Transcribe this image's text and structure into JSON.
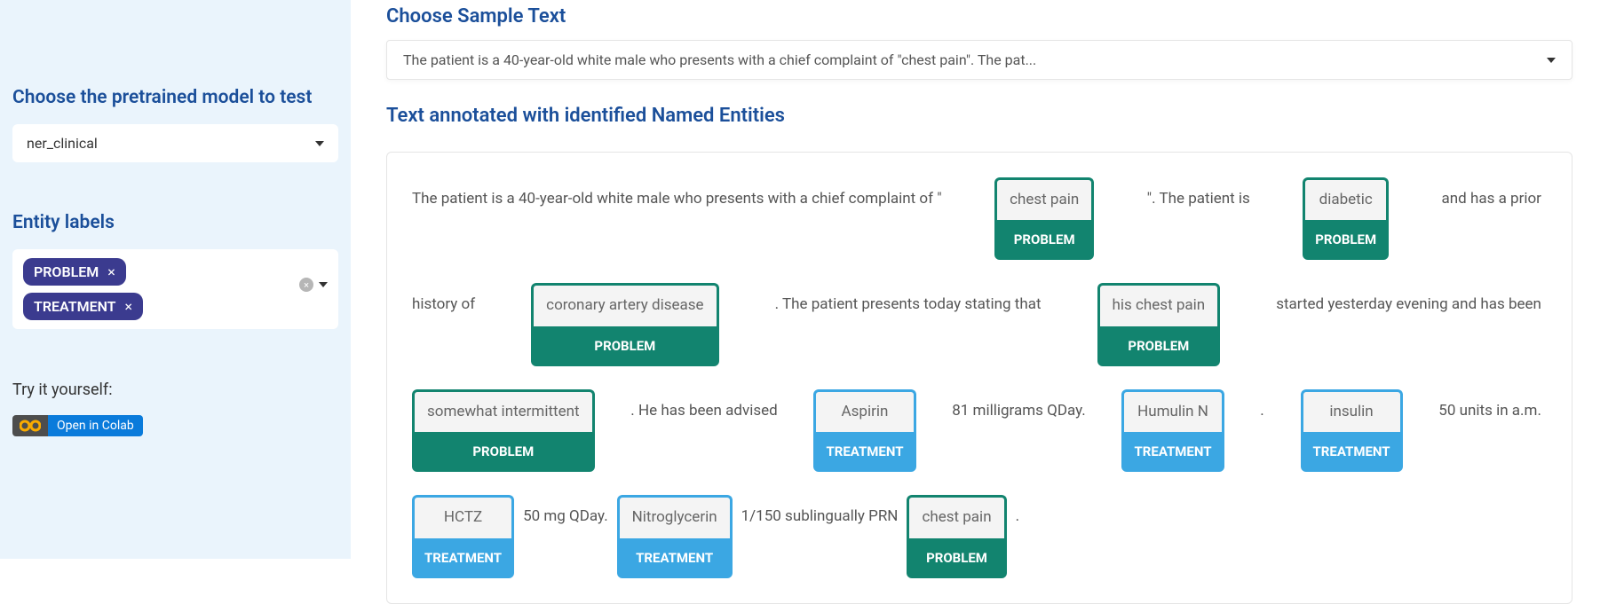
{
  "sidebar": {
    "model_heading": "Choose the pretrained model to test",
    "model_selected": "ner_clinical",
    "entity_heading": "Entity labels",
    "chips": [
      "PROBLEM",
      "TREATMENT"
    ],
    "try_it": "Try it yourself:",
    "colab_label": "Open in Colab"
  },
  "main": {
    "sample_heading": "Choose Sample Text",
    "sample_selected": "The patient is a 40-year-old white male who presents with a chief complaint of \"chest pain\". The pat...",
    "annotated_heading": "Text annotated with identified Named Entities",
    "lines": [
      [
        {
          "t": "text",
          "v": "The patient is a 40-year-old white male who presents with a chief complaint of \" "
        },
        {
          "t": "ent",
          "v": "chest pain",
          "l": "PROBLEM"
        },
        {
          "t": "text",
          "v": " \". The patient is "
        },
        {
          "t": "ent",
          "v": "diabetic",
          "l": "PROBLEM"
        },
        {
          "t": "text",
          "v": " and has a prior"
        }
      ],
      [
        {
          "t": "text",
          "v": "history of "
        },
        {
          "t": "ent",
          "v": "coronary artery disease",
          "l": "PROBLEM"
        },
        {
          "t": "text",
          "v": ". The patient presents today stating that "
        },
        {
          "t": "ent",
          "v": "his chest pain",
          "l": "PROBLEM"
        },
        {
          "t": "text",
          "v": " started yesterday evening and has been"
        }
      ],
      [
        {
          "t": "ent",
          "v": "somewhat intermittent",
          "l": "PROBLEM"
        },
        {
          "t": "text",
          "v": ". He has been advised "
        },
        {
          "t": "ent",
          "v": "Aspirin",
          "l": "TREATMENT"
        },
        {
          "t": "text",
          "v": " 81 milligrams QDay. "
        },
        {
          "t": "ent",
          "v": "Humulin N",
          "l": "TREATMENT"
        },
        {
          "t": "text",
          "v": " . "
        },
        {
          "t": "ent",
          "v": "insulin",
          "l": "TREATMENT"
        },
        {
          "t": "text",
          "v": " 50 units in a.m."
        }
      ],
      [
        {
          "t": "ent",
          "v": "HCTZ",
          "l": "TREATMENT"
        },
        {
          "t": "text",
          "v": " 50 mg QDay. "
        },
        {
          "t": "ent",
          "v": "Nitroglycerin",
          "l": "TREATMENT"
        },
        {
          "t": "text",
          "v": " 1/150 sublingually PRN "
        },
        {
          "t": "ent",
          "v": "chest pain",
          "l": "PROBLEM"
        },
        {
          "t": "text",
          "v": " ."
        }
      ]
    ]
  }
}
